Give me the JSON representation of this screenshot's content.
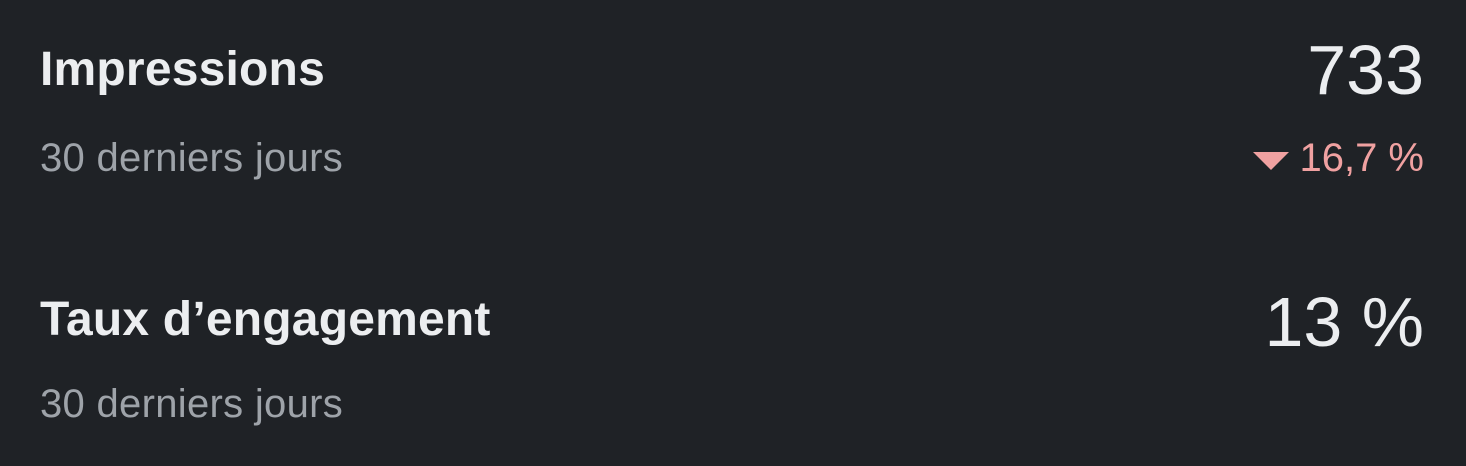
{
  "metrics": [
    {
      "title": "Impressions",
      "period": "30 derniers jours",
      "value": "733",
      "change": {
        "direction": "down",
        "text": "16,7 %",
        "color": "#f0a1a1",
        "icon": "triangle-down-icon"
      }
    },
    {
      "title": "Taux d’engagement",
      "period": "30 derniers jours",
      "value": "13 %"
    }
  ],
  "colors": {
    "background": "#1f2226",
    "primary_text": "#eceef0",
    "secondary_text": "#9ea3a9",
    "negative": "#f0a1a1"
  }
}
